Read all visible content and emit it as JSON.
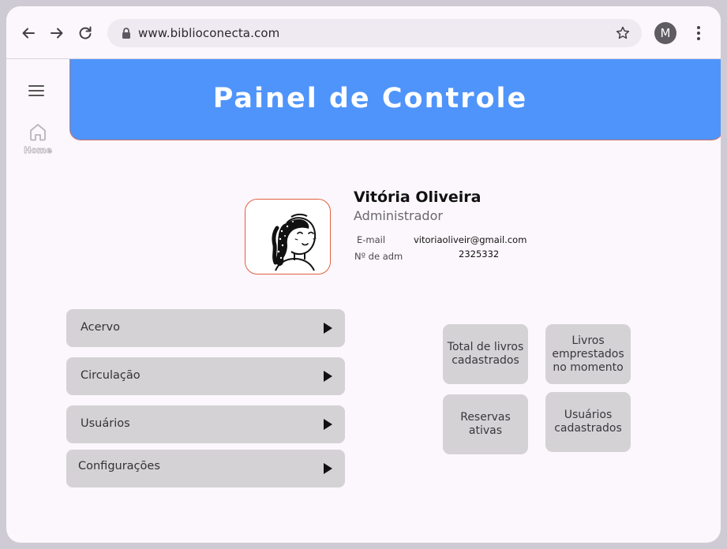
{
  "browser": {
    "url": "www.biblioconecta.com",
    "profile_initial": "M"
  },
  "sidebar": {
    "home_label": "Home"
  },
  "header": {
    "title": "Painel de Controle"
  },
  "profile": {
    "name": "Vitória Oliveira",
    "role": "Administrador",
    "email_label": "E-mail",
    "email_value": "vitoriaoliveir@gmail.com",
    "adm_label": "Nº de adm",
    "adm_value": "2325332"
  },
  "menu": {
    "items": [
      {
        "label": "Acervo"
      },
      {
        "label": "Circulação"
      },
      {
        "label": "Usuários"
      },
      {
        "label": "Configurações"
      }
    ]
  },
  "stats": {
    "total_books": "Total de livros\ncadastrados",
    "loaned_books": "Livros\nemprestados\nno momento",
    "active_reservations": "Reservas\nativas",
    "registered_users": "Usuários\ncadastrados"
  },
  "colors": {
    "banner": "#4f94fb",
    "banner_border": "#d2726c",
    "avatar_border": "#e0603f",
    "card": "#d4d2d4",
    "background": "#fcf7fc"
  }
}
